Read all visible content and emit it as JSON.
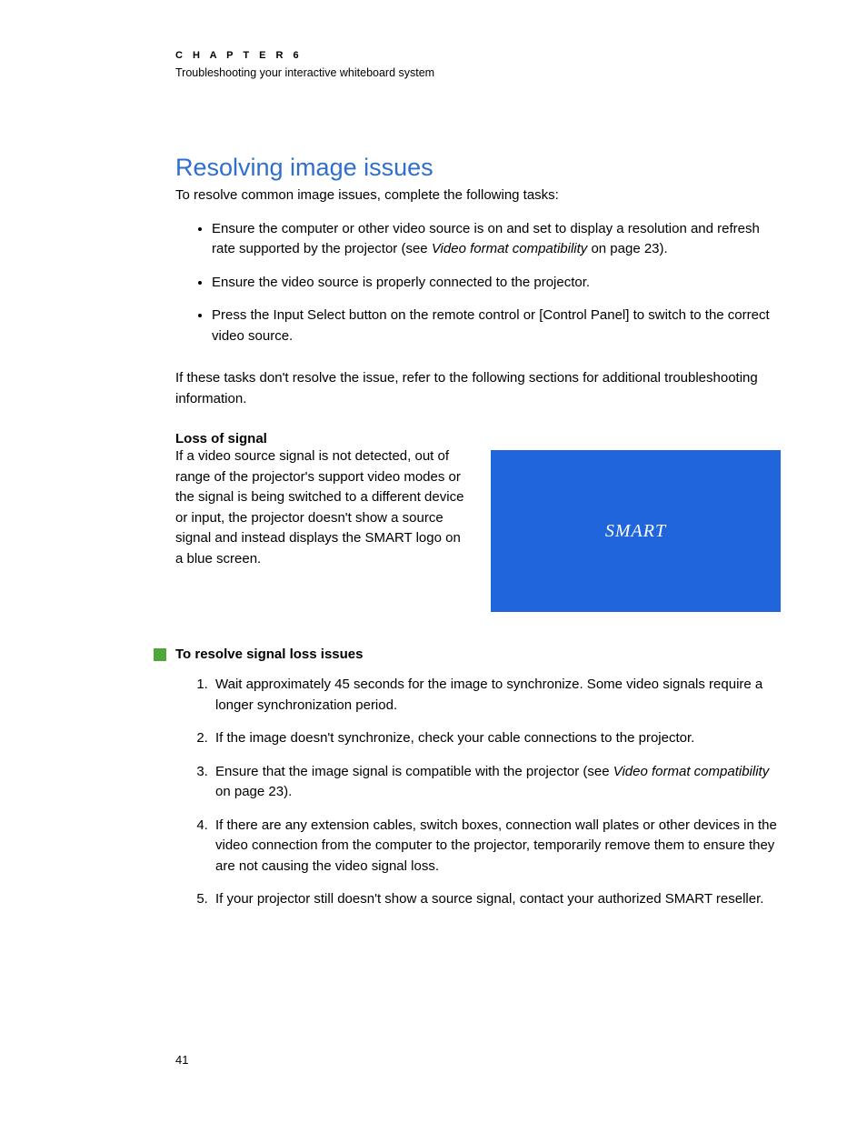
{
  "chapter_label": "C H A P T E R 6",
  "chapter_subtitle": "Troubleshooting your interactive whiteboard system",
  "section_title": "Resolving image issues",
  "intro": "To resolve common image issues, complete the following tasks:",
  "task_items": [
    {
      "pre": "Ensure the computer or other video source is on and set to display a resolution and refresh rate supported by the projector (see ",
      "ref": "Video format compatibility",
      "post": " on page 23)."
    },
    {
      "pre": "Ensure the video source is properly connected to the projector.",
      "ref": "",
      "post": ""
    },
    {
      "pre": "Press the Input Select button on the remote control or [Control Panel] to switch to the correct video source.",
      "ref": "",
      "post": ""
    }
  ],
  "followup": "If these tasks don't resolve the issue, refer to the following sections for additional troubleshooting information.",
  "loss_heading": "Loss of signal",
  "loss_text": "If a video source signal is not detected, out of range of the projector's support video modes or the signal is being switched to a different device or input, the projector doesn't show a source signal and instead displays the SMART logo on a blue screen.",
  "logo_text": "SMART",
  "procedure_title": "To resolve signal loss issues",
  "steps": [
    {
      "pre": "Wait approximately 45 seconds for the image to synchronize. Some video signals require a longer synchronization period.",
      "ref": "",
      "post": ""
    },
    {
      "pre": "If the image doesn't synchronize, check your cable connections to the projector.",
      "ref": "",
      "post": ""
    },
    {
      "pre": "Ensure that the image signal is compatible with the projector (see ",
      "ref": "Video format compatibility",
      "post": " on page 23)."
    },
    {
      "pre": "If there are any extension cables, switch boxes, connection wall plates or other devices in the video connection from the computer to the projector, temporarily remove them to ensure they are not causing the video signal loss.",
      "ref": "",
      "post": ""
    },
    {
      "pre": "If your projector still doesn't show a source signal, contact your authorized SMART reseller.",
      "ref": "",
      "post": ""
    }
  ],
  "page_number": "41"
}
